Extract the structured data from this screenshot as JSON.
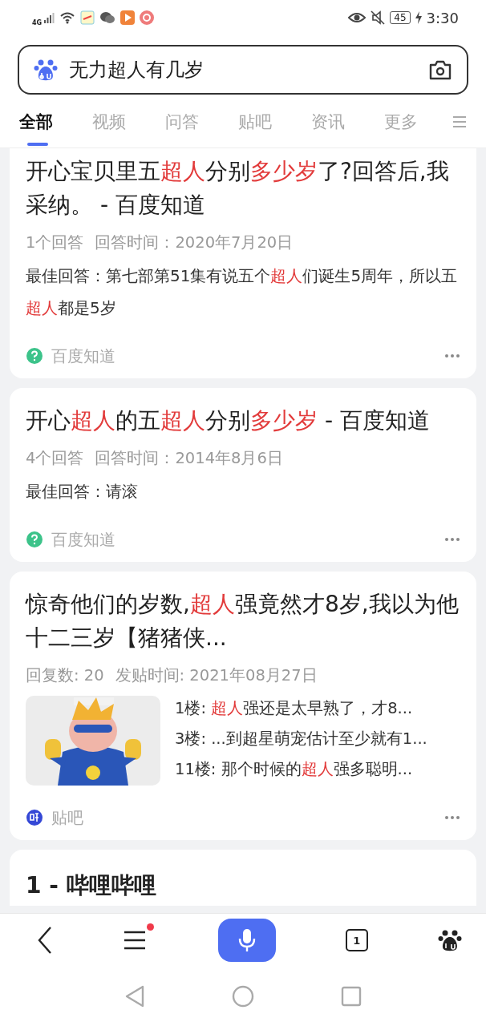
{
  "status_bar": {
    "network": "4G",
    "battery": "45",
    "time": "3:30"
  },
  "search": {
    "value": "无力超人有几岁"
  },
  "tabs": [
    {
      "label": "全部",
      "selected": true
    },
    {
      "label": "视频",
      "selected": false
    },
    {
      "label": "问答",
      "selected": false
    },
    {
      "label": "贴吧",
      "selected": false
    },
    {
      "label": "资讯",
      "selected": false
    },
    {
      "label": "更多",
      "selected": false
    }
  ],
  "results": [
    {
      "kind": "qa",
      "title": "开心宝贝里五**超人**分别**多少岁**了?回答后,我采纳。 - 百度知道",
      "meta": [
        "1个回答",
        "回答时间：2020年7月20日"
      ],
      "answer": "最佳回答：第七部第51集有说五个**超人**们诞生5周年，所以五**超人**都是5岁",
      "source": "百度知道"
    },
    {
      "kind": "qa",
      "title": "开心**超人**的五**超人**分别**多少岁** - 百度知道",
      "meta": [
        "4个回答",
        "回答时间：2014年8月6日"
      ],
      "answer": "最佳回答：请滚",
      "source": "百度知道"
    },
    {
      "kind": "forum",
      "title": "惊奇他们的岁数,**超人**强竟然才8岁,我以为他十二三岁【猪猪侠...",
      "meta": [
        "回复数: 20",
        "发贴时间: 2021年08月27日"
      ],
      "replies": [
        "1楼: **超人**强还是太早熟了，才8...",
        "3楼: ...到超星萌宠估计至少就有1...",
        "11楼: 那个时候的**超人**强多聪明..."
      ],
      "source": "贴吧"
    },
    {
      "kind": "partial",
      "title": "1 - 哔哩哔哩"
    }
  ],
  "bottom_nav": {
    "tabs_count": "1",
    "menu_badge": true
  }
}
